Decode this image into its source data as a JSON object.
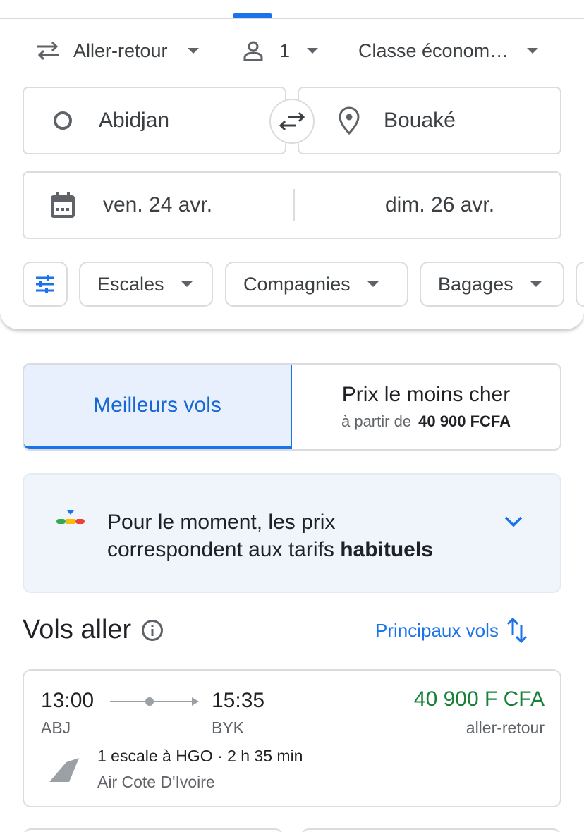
{
  "search": {
    "trip_type": "Aller-retour",
    "passengers": "1",
    "cabin_class": "Classe économ…",
    "origin": "Abidjan",
    "destination": "Bouaké",
    "depart_date": "ven. 24 avr.",
    "return_date": "dim. 26 avr."
  },
  "filters": [
    {
      "label": "Escales"
    },
    {
      "label": "Compagnies"
    },
    {
      "label": "Bagages"
    }
  ],
  "sort_toggle": {
    "best_label": "Meilleurs vols",
    "cheapest_label": "Prix le moins cher",
    "cheapest_prefix": "à partir de",
    "cheapest_price": "40 900 FCFA"
  },
  "insight": {
    "text_line1": "Pour le moment, les prix",
    "text_line2_prefix": "correspondent aux tarifs ",
    "text_line2_bold": "habituels"
  },
  "results": {
    "title": "Vols aller",
    "sort_label": "Principaux vols",
    "flights": [
      {
        "depart_time": "13:00",
        "arrive_time": "15:35",
        "depart_airport": "ABJ",
        "arrive_airport": "BYK",
        "price": "40 900 F CFA",
        "price_note": "aller-retour",
        "stops": "1 escale à HGO · 2 h 35 min",
        "airline": "Air Cote D'Ivoire"
      }
    ]
  },
  "colors": {
    "accent": "#1a73e8",
    "price_green": "#188038",
    "insight_bg": "#f0f5fc"
  }
}
